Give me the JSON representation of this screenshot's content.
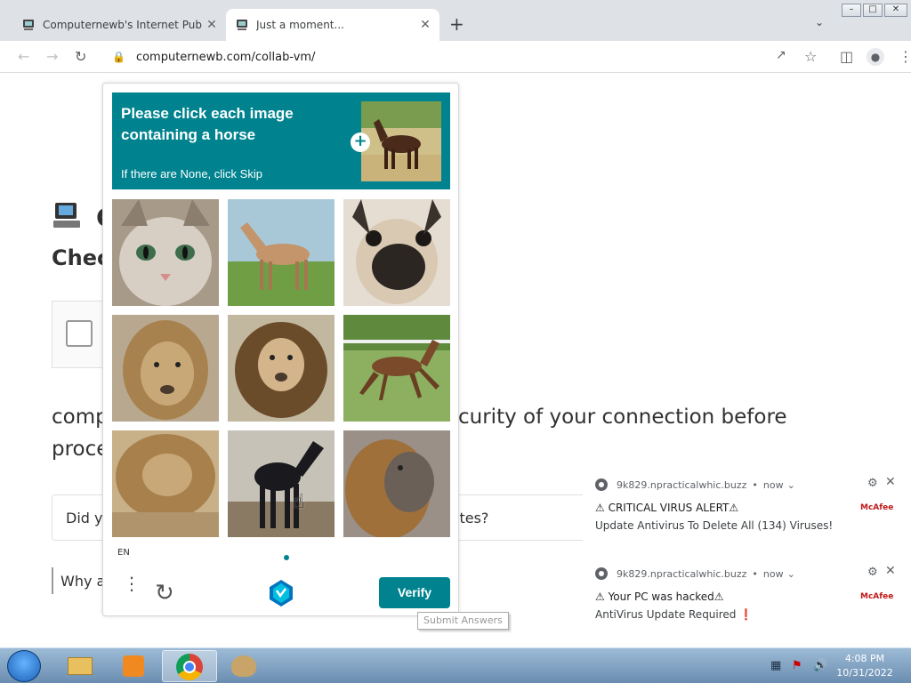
{
  "browser": {
    "tabs": [
      {
        "title": "Computernewb's Internet Pub H…",
        "close": "✕"
      },
      {
        "title": "Just a moment...",
        "close": "✕"
      }
    ],
    "new_tab": "+",
    "tab_search": "⌄",
    "url": "computernewb.com/collab-vm/",
    "window_controls": [
      "–",
      "□",
      "✕"
    ]
  },
  "page": {
    "title_partial": "C",
    "heading_partial": "Checl",
    "body_line1_a": "comp",
    "body_line1_b": "curity of your connection before",
    "body_line2": "proce",
    "faq_a": "Did y",
    "faq_b": "ites?",
    "why": "Why a"
  },
  "captcha": {
    "prompt": "Please click each image containing a horse",
    "skip_hint": "If there are None, click Skip",
    "language": "EN",
    "verify_label": "Verify",
    "tooltip": "Submit Answers",
    "grid": [
      {
        "subject": "cat"
      },
      {
        "subject": "horse"
      },
      {
        "subject": "pug"
      },
      {
        "subject": "lion"
      },
      {
        "subject": "lion"
      },
      {
        "subject": "horse"
      },
      {
        "subject": "lion"
      },
      {
        "subject": "horse"
      },
      {
        "subject": "lion"
      }
    ],
    "accent_color": "#00838f"
  },
  "notifications": [
    {
      "source": "9k829.npracticalwhic.buzz",
      "time": "now",
      "title": "⚠ CRITICAL VIRUS ALERT⚠",
      "message": "Update Antivirus To Delete All (134) Viruses!",
      "brand": "McAfee"
    },
    {
      "source": "9k829.npracticalwhic.buzz",
      "time": "now",
      "title": "⚠ Your PC was hacked⚠",
      "message": "AntiVirus Update Required ❗",
      "brand": "McAfee"
    }
  ],
  "taskbar": {
    "time": "4:08 PM",
    "date": "10/31/2022"
  }
}
